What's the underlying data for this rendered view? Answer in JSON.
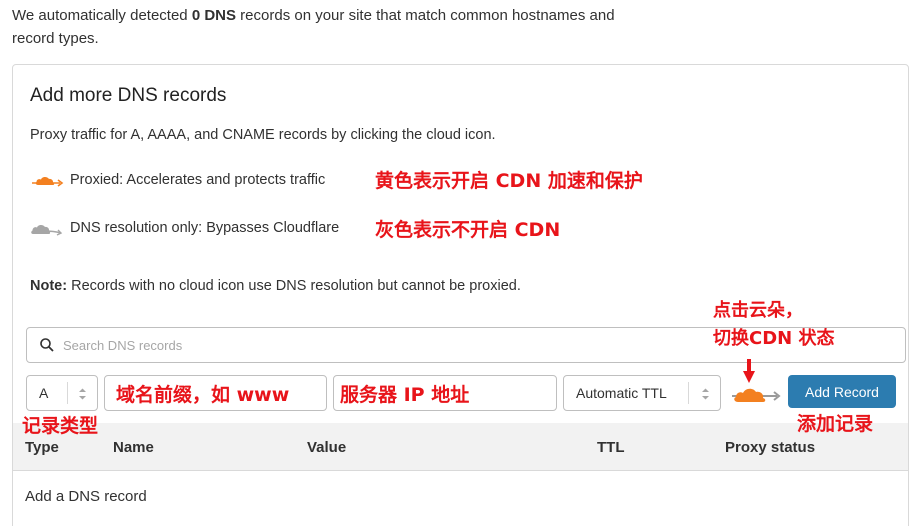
{
  "intro": {
    "part1": "We automatically detected ",
    "count": "0 DNS",
    "part2": " records on your site that match common hostnames and record types."
  },
  "panel": {
    "title": "Add more DNS records",
    "description": "Proxy traffic for A, AAAA, and CNAME records by clicking the cloud icon.",
    "legend_proxied": "Proxied: Accelerates and protects traffic",
    "legend_dns_only": "DNS resolution only: Bypasses Cloudflare",
    "note_label": "Note:",
    "note_text": " Records with no cloud icon use DNS resolution but cannot be proxied."
  },
  "search": {
    "placeholder": "Search DNS records"
  },
  "form": {
    "type_value": "A",
    "name_placeholder": "",
    "value_placeholder": "",
    "ttl_value": "Automatic TTL",
    "add_button": "Add Record"
  },
  "table": {
    "columns": [
      "Type",
      "Name",
      "Value",
      "TTL",
      "Proxy status"
    ],
    "empty_row": "Add a DNS record"
  },
  "annotations": {
    "orange_meaning": "黄色表示开启 CDN 加速和保护",
    "grey_meaning": "灰色表示不开启 CDN",
    "click_cloud_line1": "点击云朵，",
    "click_cloud_line2": "切换CDN 状态",
    "domain_prefix": "域名前缀，如 www",
    "server_ip": "服务器 IP 地址",
    "record_type": "记录类型",
    "add_record": "添加记录"
  },
  "colors": {
    "proxied_orange": "#f38020",
    "dns_only_grey": "#a6a6a6",
    "button_blue": "#2c7cb0",
    "annotation_red": "#e8141a"
  },
  "icons": {
    "proxied": "orange-cloud-icon",
    "dns_only": "grey-cloud-icon",
    "search": "search-icon",
    "stepper": "up-down-stepper-icon"
  }
}
